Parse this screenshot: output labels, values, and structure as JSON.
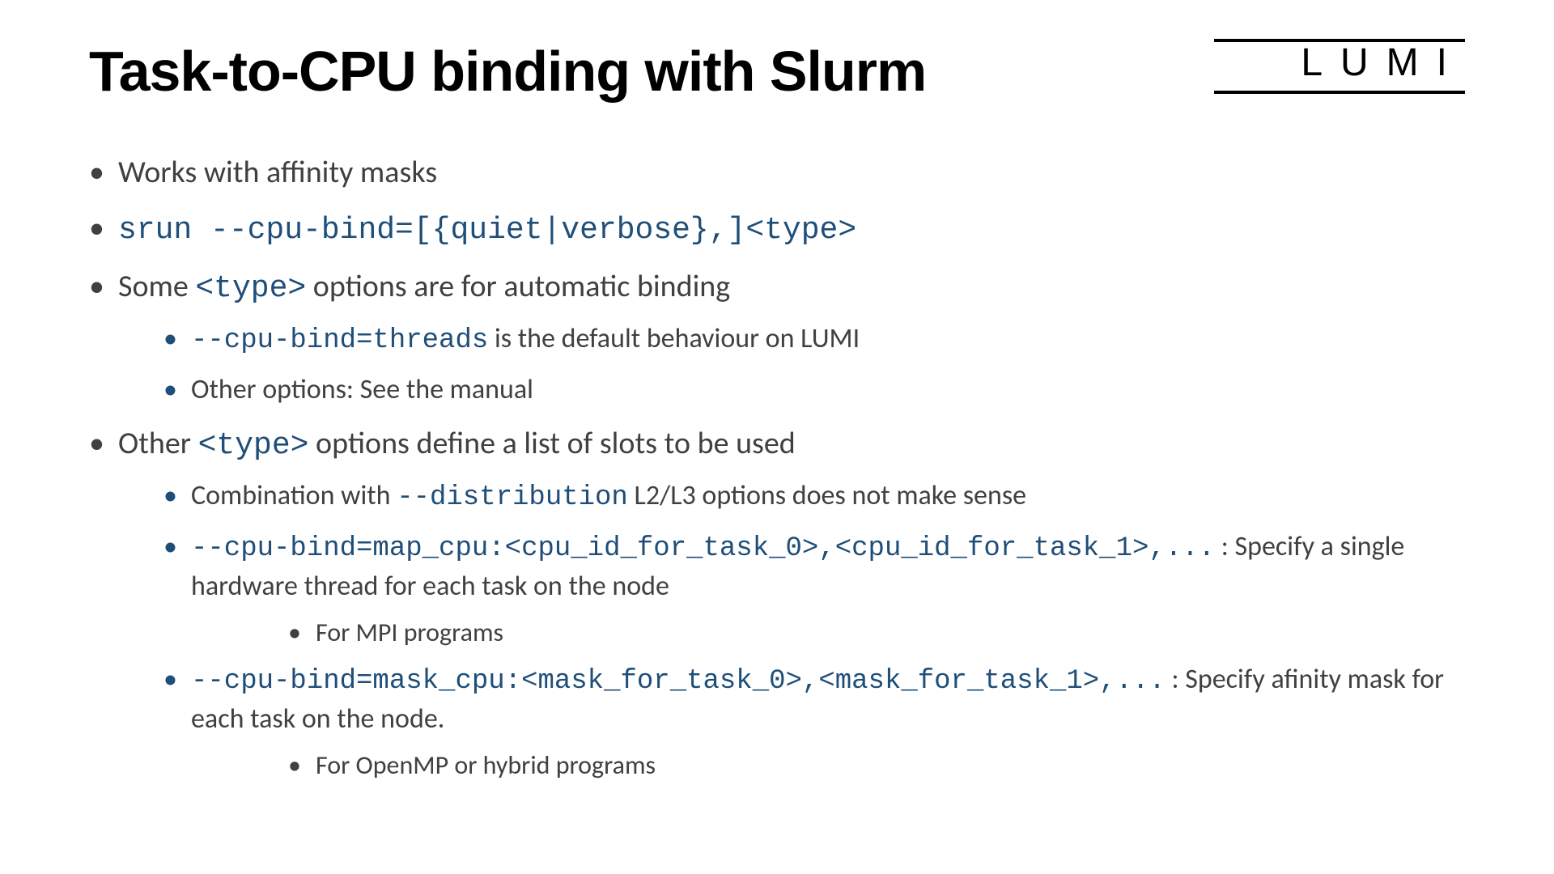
{
  "logo": "LUMI",
  "title": "Task-to-CPU binding with Slurm",
  "b1": "Works with affinity masks",
  "b2_code": "srun --cpu-bind=[{quiet|verbose},]<type>",
  "b3_pre": "Some ",
  "b3_code": "<type>",
  "b3_post": " options are for automatic binding",
  "b3a_code": "--cpu-bind=threads",
  "b3a_post": " is the default behaviour on LUMI",
  "b3b": "Other options: See the manual",
  "b4_pre": "Other ",
  "b4_code": "<type>",
  "b4_post": " options define a list of slots to be used",
  "b4a_pre": "Combination with ",
  "b4a_code": "--distribution",
  "b4a_post": " L2/L3 options does not make sense",
  "b4b_code": "--cpu-bind=map_cpu:<cpu_id_for_task_0>,<cpu_id_for_task_1>,...",
  "b4b_post": " : Specify a single hardware thread for each task on the node",
  "b4b_i": "For MPI programs",
  "b4c_code": "--cpu-bind=mask_cpu:<mask_for_task_0>,<mask_for_task_1>,...",
  "b4c_post": " : Specify afinity mask for each task on the node.",
  "b4c_i": "For OpenMP or hybrid programs"
}
